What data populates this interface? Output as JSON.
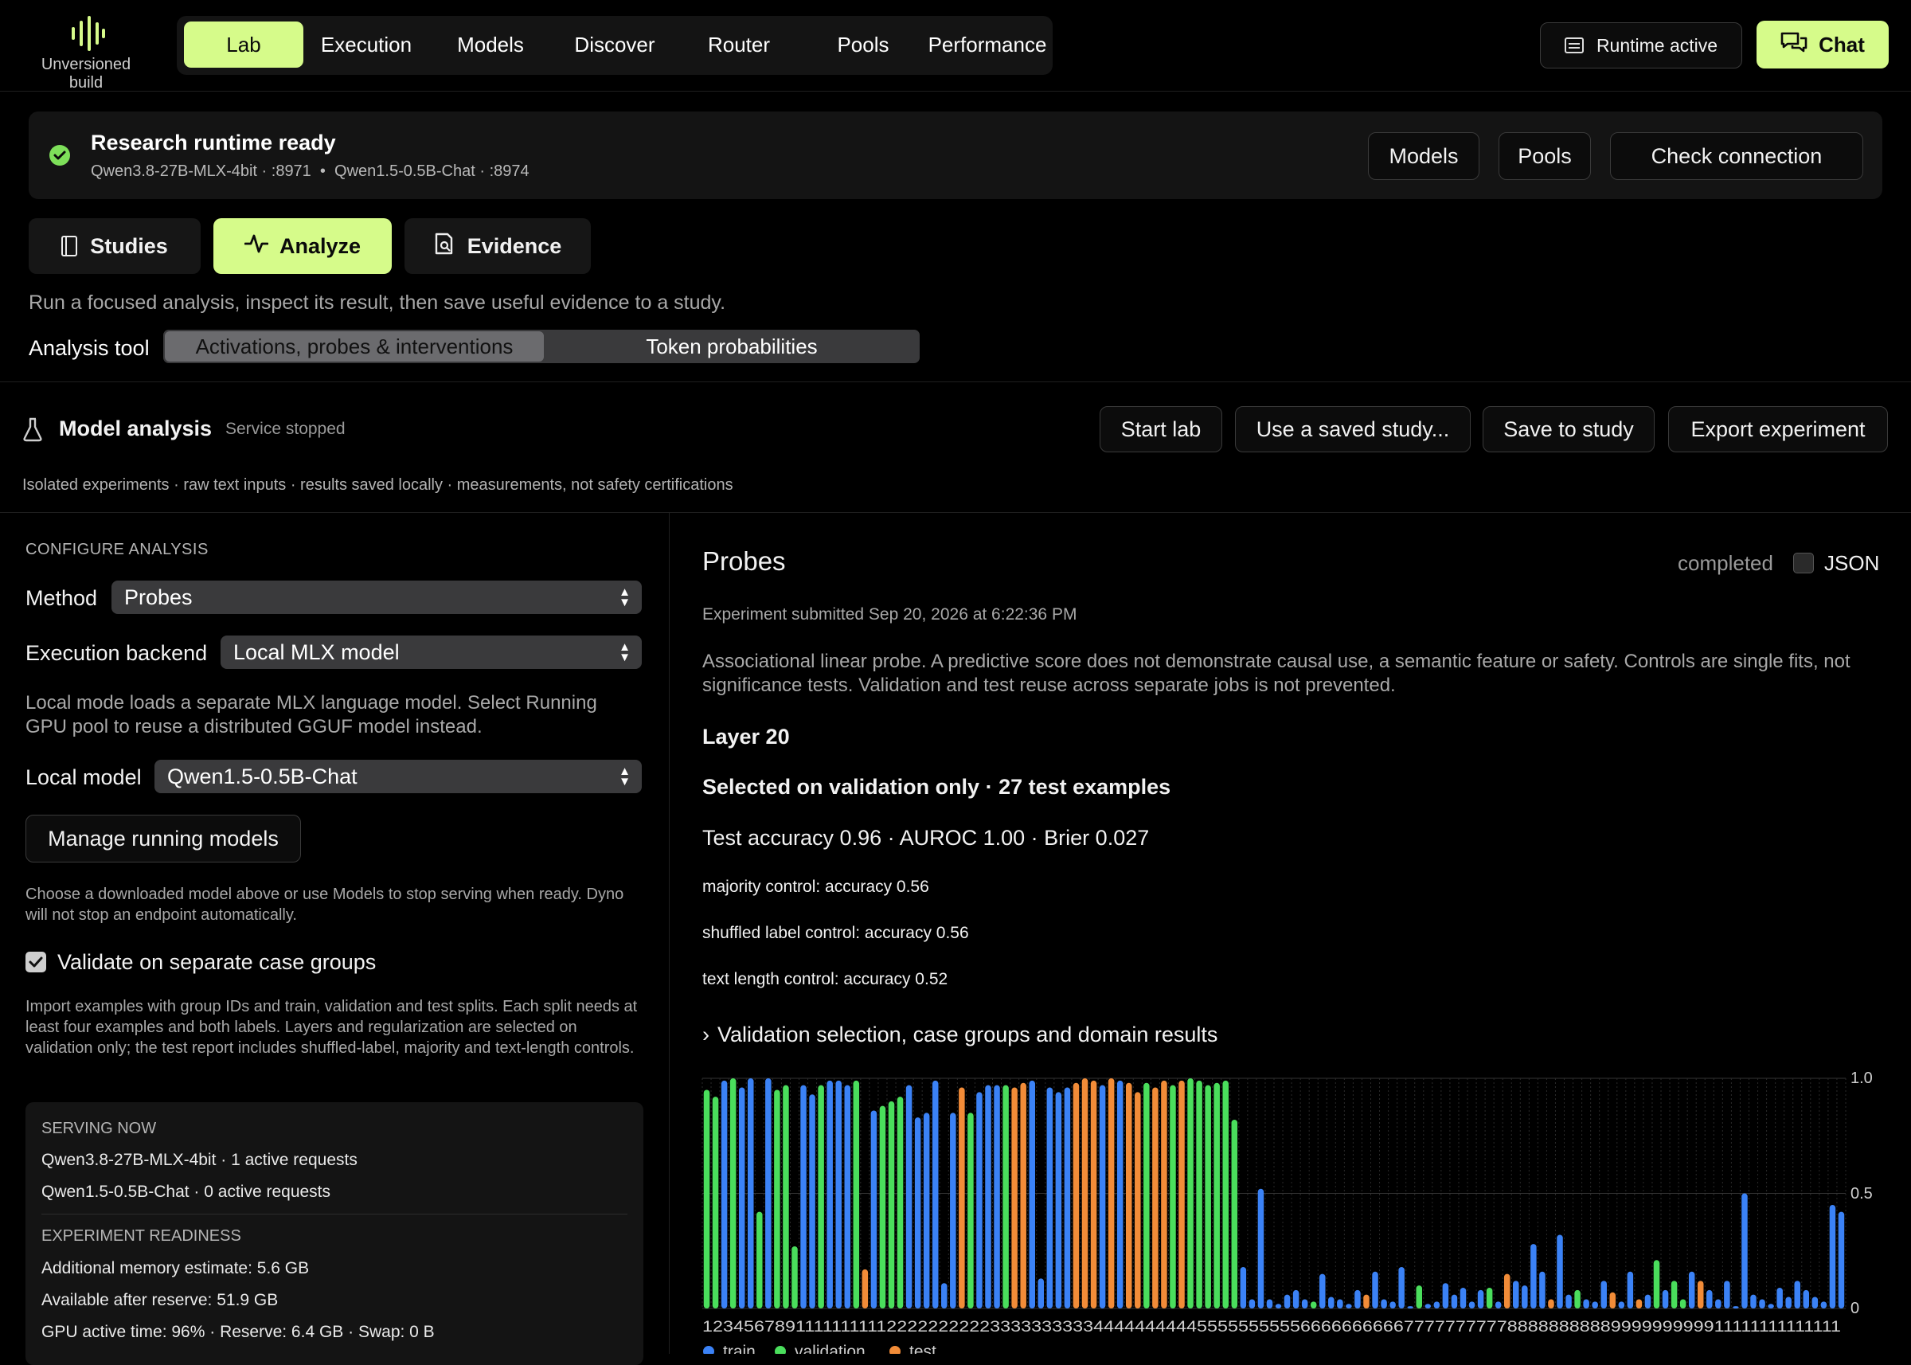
{
  "app": {
    "build_label": "Unversioned build",
    "nav": [
      "Lab",
      "Execution",
      "Models",
      "Discover",
      "Router",
      "Pools",
      "Performance"
    ],
    "runtime_status": "Runtime active",
    "chat_label": "Chat"
  },
  "banner": {
    "title": "Research runtime ready",
    "endpoints": "Qwen3.8-27B-MLX-4bit · :8971  •  Qwen1.5-0.5B-Chat · :8974",
    "buttons": [
      "Models",
      "Pools",
      "Check connection"
    ]
  },
  "tabs": [
    "Studies",
    "Analyze",
    "Evidence"
  ],
  "tagline": "Run a focused analysis, inspect its result, then save useful evidence to a study.",
  "analysis_tool": {
    "label": "Analysis tool",
    "options": [
      "Activations, probes & interventions",
      "Token probabilities"
    ]
  },
  "model_analysis": {
    "title": "Model analysis",
    "status": "Service stopped",
    "actions": [
      "Start lab",
      "Use a saved study...",
      "Save to study",
      "Export experiment"
    ],
    "subtitle": "Isolated experiments · raw text inputs · results saved locally · measurements, not safety certifications"
  },
  "config": {
    "heading": "CONFIGURE ANALYSIS",
    "method_label": "Method",
    "method_value": "Probes",
    "backend_label": "Execution backend",
    "backend_value": "Local MLX model",
    "backend_help": "Local mode loads a separate MLX language model. Select Running GPU pool to reuse a distributed GGUF model instead.",
    "local_model_label": "Local model",
    "local_model_value": "Qwen1.5-0.5B-Chat",
    "manage_button": "Manage running models",
    "manage_help": "Choose a downloaded model above or use Models to stop serving when ready. Dyno will not stop an endpoint automatically.",
    "validate_label": "Validate on separate case groups",
    "validate_checked": true,
    "import_help": "Import examples with group IDs and train, validation and test splits. Each split needs at least four examples and both labels. Layers and regularization are selected on validation only; the test report includes shuffled-label, majority and text-length controls.",
    "serving_heading": "SERVING NOW",
    "serving": [
      "Qwen3.8-27B-MLX-4bit · 1 active requests",
      "Qwen1.5-0.5B-Chat · 0 active requests"
    ],
    "readiness_heading": "EXPERIMENT READINESS",
    "readiness": [
      "Additional memory estimate: 5.6 GB",
      "Available after reserve: 51.9 GB",
      "GPU active time: 96% · Reserve: 6.4 GB · Swap: 0 B"
    ]
  },
  "result": {
    "title": "Probes",
    "status": "completed",
    "json_label": "JSON",
    "submitted": "Experiment submitted Sep 20, 2026 at 6:22:36 PM",
    "disclaimer": "Associational linear probe. A predictive score does not demonstrate causal use, a semantic feature or safety. Controls are single fits, not significance tests. Validation and test reuse across separate jobs is not prevented.",
    "layer": "Layer 20",
    "selection": "Selected on validation only · 27 test examples",
    "metrics": "Test accuracy 0.96 · AUROC 1.00 · Brier 0.027",
    "controls": [
      "majority control: accuracy 0.56",
      "shuffled label control: accuracy 0.56",
      "text length control: accuracy 0.52"
    ],
    "details_toggle": "Validation selection, case groups and domain results"
  },
  "colors": {
    "accent": "#d6fb8a",
    "train": "#3b82f6",
    "validation": "#4ade5c",
    "test": "#f28c38"
  },
  "chart_data": {
    "type": "bar",
    "y_ticks": [
      "1.0",
      "0.5",
      "0"
    ],
    "ylim": [
      0,
      1
    ],
    "x_tick_text": "12345678911111111112222222222333333333344444444445555555555666666666677777777778888888888999999999911111111111111",
    "legend": [
      "train",
      "validation",
      "test"
    ],
    "series_order": [
      "v",
      "v",
      "b",
      "v",
      "b",
      "b",
      "v",
      "b",
      "v",
      "v",
      "v",
      "b",
      "b",
      "v",
      "b",
      "b",
      "b",
      "v",
      "o",
      "b",
      "v",
      "v",
      "v",
      "b",
      "b",
      "b",
      "b",
      "b",
      "b",
      "o",
      "v",
      "b",
      "b",
      "b",
      "v",
      "o",
      "o",
      "b",
      "b",
      "b",
      "b",
      "b",
      "o",
      "o",
      "o",
      "b",
      "o",
      "b",
      "o",
      "o",
      "v",
      "o",
      "o",
      "v",
      "o",
      "v",
      "v",
      "v",
      "v",
      "v",
      "v",
      "b",
      "b",
      "b",
      "b",
      "b",
      "b",
      "b",
      "b",
      "v",
      "b",
      "b",
      "b",
      "b",
      "b",
      "o",
      "b",
      "b",
      "b",
      "b",
      "b",
      "v",
      "b",
      "b",
      "b",
      "b",
      "b",
      "b",
      "b",
      "v",
      "b",
      "o",
      "b",
      "b",
      "b",
      "b",
      "o",
      "b",
      "b",
      "v",
      "b",
      "b",
      "b",
      "o",
      "b",
      "b",
      "o",
      "b",
      "v",
      "b",
      "v",
      "v",
      "b",
      "o"
    ],
    "values": [
      0.95,
      0.92,
      0.99,
      1.0,
      0.96,
      1.0,
      0.42,
      1.0,
      0.95,
      0.97,
      0.27,
      0.97,
      0.93,
      0.97,
      0.99,
      0.99,
      0.97,
      0.99,
      0.17,
      0.86,
      0.88,
      0.9,
      0.92,
      0.97,
      0.83,
      0.85,
      0.99,
      0.11,
      0.85,
      0.96,
      0.85,
      0.94,
      0.97,
      0.97,
      0.97,
      0.96,
      0.98,
      0.99,
      0.13,
      0.96,
      0.94,
      0.96,
      0.98,
      1.0,
      0.99,
      0.97,
      1.0,
      0.99,
      0.98,
      0.94,
      0.98,
      0.96,
      0.99,
      0.97,
      0.99,
      1.0,
      0.99,
      0.97,
      0.98,
      0.99,
      0.82,
      0.18,
      0.04,
      0.52,
      0.04,
      0.02,
      0.06,
      0.08,
      0.04,
      0.03,
      0.15,
      0.05,
      0.04,
      0.02,
      0.08,
      0.06,
      0.16,
      0.04,
      0.03,
      0.18,
      0.01,
      0.1,
      0.02,
      0.03,
      0.11,
      0.06,
      0.09,
      0.03,
      0.08,
      0.09,
      0.03,
      0.15,
      0.12,
      0.1,
      0.28,
      0.16,
      0.04,
      0.32,
      0.06,
      0.08,
      0.04,
      0.03,
      0.12,
      0.07,
      0.03,
      0.16,
      0.04,
      0.06,
      0.21,
      0.08,
      0.12,
      0.04,
      0.16,
      0.12,
      0.08,
      0.04,
      0.12,
      0.01,
      0.5,
      0.06,
      0.04,
      0.02,
      0.09,
      0.05,
      0.12,
      0.08,
      0.05,
      0.03,
      0.45,
      0.42
    ]
  }
}
